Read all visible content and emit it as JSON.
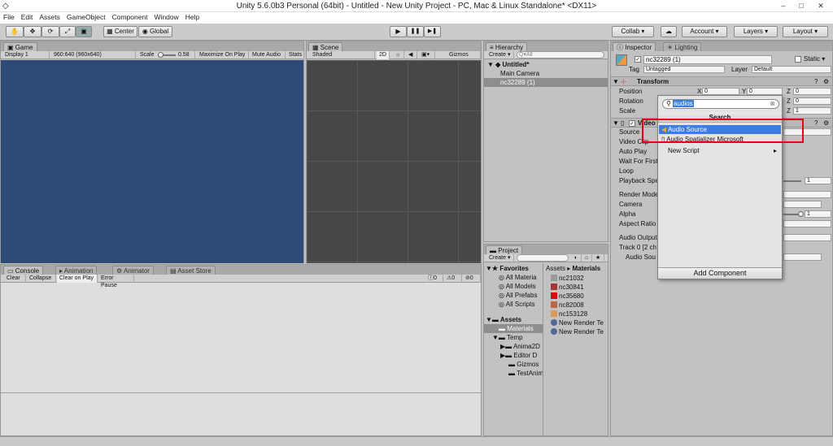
{
  "window": {
    "title": "Unity 5.6.0b3 Personal (64bit) - Untitled - New Unity Project - PC, Mac & Linux Standalone* <DX11>",
    "controls": [
      "–",
      "□",
      "✕"
    ]
  },
  "menu": [
    "File",
    "Edit",
    "Assets",
    "GameObject",
    "Component",
    "Window",
    "Help"
  ],
  "toolbar": {
    "tools": [
      "✋",
      "✥",
      "⟳",
      "⤢",
      "▣"
    ],
    "pivot": "Center",
    "space": "Global",
    "play": "▶",
    "pause": "❚❚",
    "step": "▶❚",
    "collab": "Collab ▾",
    "cloud": "☁",
    "account": "Account",
    "layers": "Layers",
    "layout": "Layout"
  },
  "game": {
    "tab": "Game",
    "display": "Display 1",
    "resolution": "960:640 (960x640)",
    "scale_label": "Scale",
    "scale_value": "0.58",
    "maximize": "Maximize On Play",
    "mute": "Mute Audio",
    "stats": "Stats",
    "bg": "#2e4a78"
  },
  "scene": {
    "tab": "Scene",
    "shading": "Shaded",
    "mode2d": "2D",
    "gizmos": "Gizmos",
    "bg": "#474747"
  },
  "hierarchy": {
    "tab": "Hierarchy",
    "create": "Create",
    "search": "Q▾All",
    "scene": "Untitled*",
    "items": [
      "Main Camera",
      "nc32289 (1)"
    ]
  },
  "project": {
    "tab": "Project",
    "create": "Create",
    "favorites_label": "Favorites",
    "favorites": [
      "All Materia",
      "All Models",
      "All Prefabs",
      "All Scripts"
    ],
    "assets_label": "Assets",
    "asset_tree": [
      "Materials",
      "Temp",
      "Anima2D",
      "Editor D",
      "Gizmos",
      "TestAnim"
    ],
    "breadcrumb": [
      "Assets",
      "Materials"
    ],
    "files": [
      "nc21032",
      "nc30841",
      "nc35680",
      "nc82008",
      "nc153128",
      "New Render Te",
      "New Render Te"
    ]
  },
  "console": {
    "tabs": [
      "Console",
      "Animation",
      "Animator",
      "Asset Store"
    ],
    "buttons": [
      "Clear",
      "Collapse",
      "Clear on Play",
      "Error Pause"
    ],
    "counts": [
      "0",
      "0",
      "0"
    ]
  },
  "inspector": {
    "tabs": [
      "Inspector",
      "Lighting"
    ],
    "object_name": "nc32289 (1)",
    "static_label": "Static",
    "tag_label": "Tag",
    "tag_value": "Untagged",
    "layer_label": "Layer",
    "layer_value": "Default",
    "transform_title": "Transform",
    "transform_rows": [
      {
        "label": "Position",
        "x": "0",
        "y": "0",
        "z": "0"
      },
      {
        "label": "Rotation",
        "x": "0",
        "y": "0",
        "z": "0"
      },
      {
        "label": "Scale",
        "x": "1",
        "y": "1",
        "z": "1"
      }
    ],
    "video_title": "Video",
    "video_labels": [
      "Source",
      "Video Clip",
      "Auto Play",
      "Wait For First",
      "Loop",
      "Playback Spe",
      "Render Mode",
      "Camera",
      "Alpha",
      "Aspect Ratio",
      "Audio Output",
      "Track 0 [2 ch",
      "Audio Sou"
    ],
    "playback_value": "1",
    "alpha_value": "1",
    "add_component": "Add Component"
  },
  "search_popup": {
    "query": "audios",
    "header": "Search",
    "results": [
      "Audio Source",
      "Audio Spatializer Microsoft",
      "New Script"
    ],
    "highlight_color": "#3b7de0",
    "outline_color": "#e0001b"
  }
}
